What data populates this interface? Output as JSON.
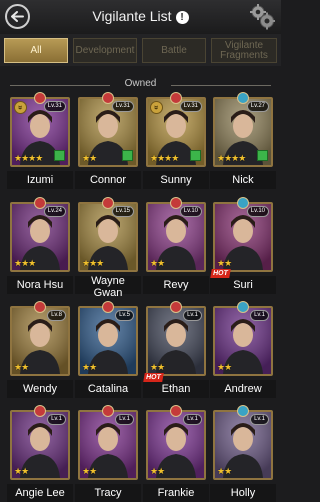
{
  "header": {
    "title": "Vigilante List",
    "info_label": "!"
  },
  "tabs": [
    {
      "label": "All",
      "active": true
    },
    {
      "label": "Development",
      "active": false
    },
    {
      "label": "Battle",
      "active": false
    },
    {
      "label": "Vigilante Fragments",
      "active": false
    }
  ],
  "section": {
    "label": "Owned"
  },
  "hot_label": "HOT",
  "characters": [
    {
      "name": "Izumi",
      "level": "Lv.31",
      "stars": 4,
      "rank": true,
      "bg": "#7a2f8f"
    },
    {
      "name": "Connor",
      "level": "Lv.31",
      "stars": 2,
      "rank": false,
      "bg": "#a78a3f"
    },
    {
      "name": "Sunny",
      "level": "Lv.31",
      "stars": 4,
      "rank": true,
      "bg": "#b08f3d"
    },
    {
      "name": "Nick",
      "level": "Lv.27",
      "stars": 4,
      "rank": false,
      "bg": "#8e8058"
    },
    {
      "name": "Nora Hsu",
      "level": "Lv.24",
      "stars": 3,
      "rank": false,
      "bg": "#6e2b7a"
    },
    {
      "name": "Wayne Gwan",
      "level": "Lv.15",
      "stars": 3,
      "rank": false,
      "bg": "#a3873f"
    },
    {
      "name": "Revy",
      "level": "Lv.10",
      "stars": 2,
      "rank": false,
      "bg": "#8b3c88"
    },
    {
      "name": "Suri",
      "level": "Lv.10",
      "stars": 2,
      "rank": false,
      "bg": "#84306f",
      "hot": true
    },
    {
      "name": "Wendy",
      "level": "Lv.8",
      "stars": 2,
      "rank": false,
      "bg": "#9a7b3a"
    },
    {
      "name": "Catalina",
      "level": "Lv.5",
      "stars": 2,
      "rank": false,
      "bg": "#2f5a8a"
    },
    {
      "name": "Ethan",
      "level": "Lv.1",
      "stars": 2,
      "rank": false,
      "bg": "#43485a",
      "hot": true
    },
    {
      "name": "Andrew",
      "level": "Lv.1",
      "stars": 2,
      "rank": false,
      "bg": "#6a2f86"
    },
    {
      "name": "Angie Lee",
      "level": "Lv.1",
      "stars": 2,
      "rank": false,
      "bg": "#6b2f80"
    },
    {
      "name": "Tracy",
      "level": "Lv.1",
      "stars": 2,
      "rank": false,
      "bg": "#7b2f8a"
    },
    {
      "name": "Frankie",
      "level": "Lv.1",
      "stars": 2,
      "rank": false,
      "bg": "#7a3390"
    },
    {
      "name": "Holly",
      "level": "Lv.1",
      "stars": 2,
      "rank": false,
      "bg": "#6c5a86"
    }
  ],
  "colors": {
    "gold": "#caa23b",
    "star": "#f1c12d",
    "hot": "#d6261a",
    "tab_active": "#b79a55"
  }
}
